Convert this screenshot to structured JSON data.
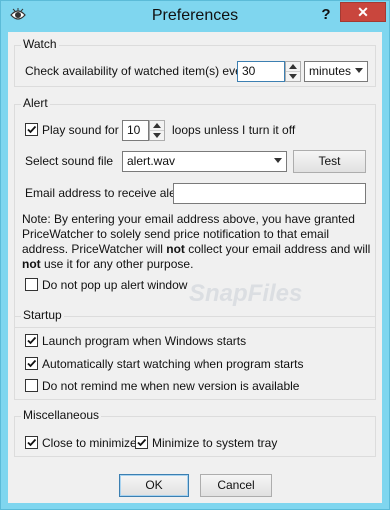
{
  "window": {
    "title": "Preferences",
    "help_label": "?",
    "close_label": "✕"
  },
  "watch": {
    "group_title": "Watch",
    "check_label": "Check availability of watched item(s) every",
    "interval_value": "30",
    "unit_selected": "minutes"
  },
  "alert": {
    "group_title": "Alert",
    "play_sound_label": "Play sound for",
    "play_sound_checked": true,
    "loops_value": "10",
    "loops_suffix": "loops unless I turn it off",
    "sound_file_label": "Select sound file",
    "sound_file_value": "alert.wav",
    "test_button": "Test",
    "email_label": "Email address to receive alert",
    "email_value": "",
    "note_part1": "Note: By entering your email address above, you have granted PriceWatcher to solely send price notification to that email address. PriceWatcher will ",
    "note_bold1": "not",
    "note_part2": " collect your email address and will ",
    "note_bold2": "not",
    "note_part3": " use it for any other purpose.",
    "no_popup_label": "Do not pop up alert window",
    "no_popup_checked": false
  },
  "startup": {
    "group_title": "Startup",
    "launch_label": "Launch program when Windows starts",
    "launch_checked": true,
    "auto_watch_label": "Automatically start watching when program starts",
    "auto_watch_checked": true,
    "no_remind_label": "Do not remind me when new version is available",
    "no_remind_checked": false
  },
  "misc": {
    "group_title": "Miscellaneous",
    "close_min_label": "Close to minimize",
    "close_min_checked": true,
    "tray_label": "Minimize to system tray",
    "tray_checked": true
  },
  "buttons": {
    "ok": "OK",
    "cancel": "Cancel"
  },
  "watermark": "SnapFiles",
  "colors": {
    "frame": "#7fd6ef",
    "close": "#c9463d",
    "focus": "#3c7fb1"
  }
}
